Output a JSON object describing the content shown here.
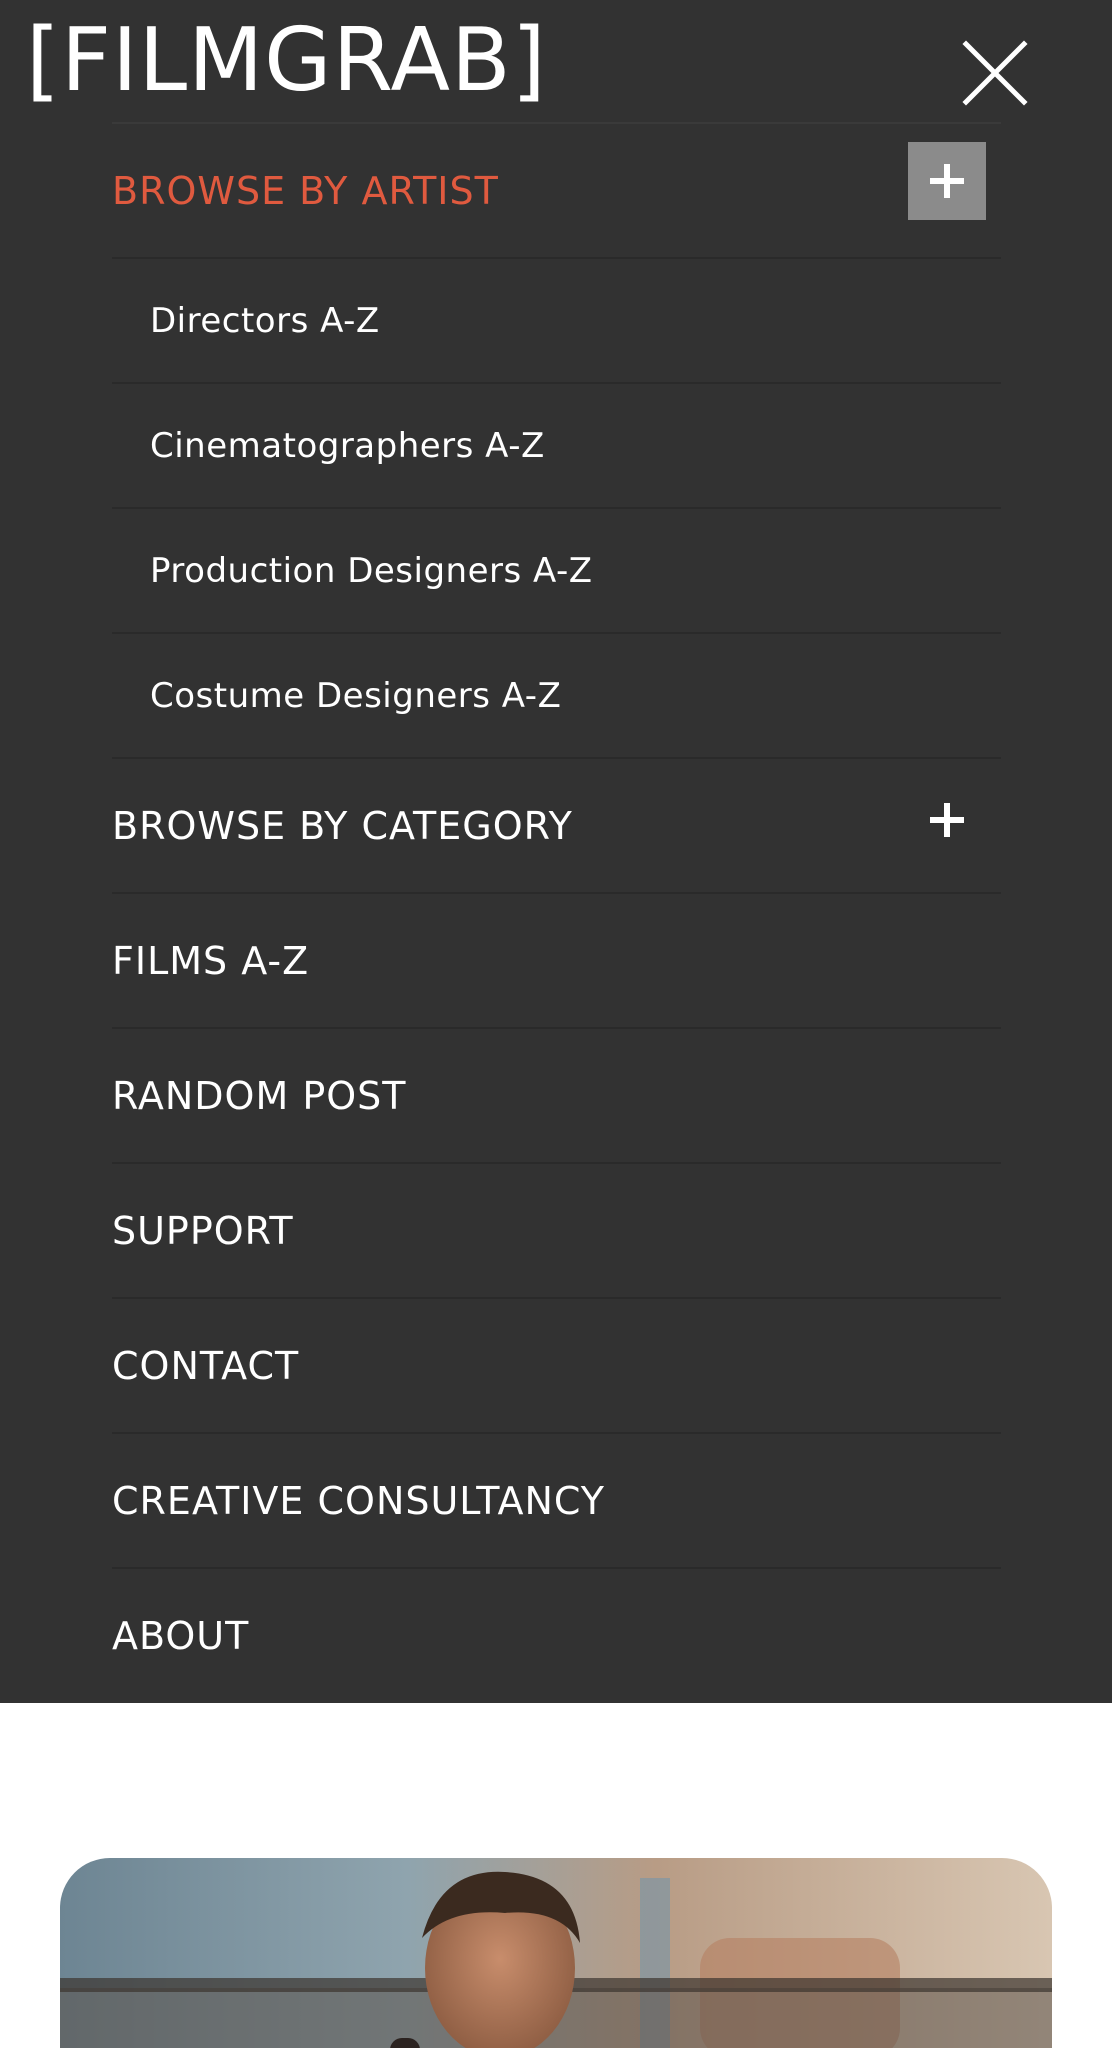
{
  "header": {
    "logo": "[FILMGRAB]",
    "close_icon": "close-icon"
  },
  "colors": {
    "menu_background": "#323232",
    "accent": "#e05a3f",
    "toggle_background": "#8b8b8b",
    "text": "#ffffff",
    "page_background": "#ffffff"
  },
  "menu": {
    "items": [
      {
        "label": "BROWSE BY ARTIST",
        "active": true,
        "expandable": true,
        "icon": "plus-icon",
        "children": [
          {
            "label": "Directors A-Z"
          },
          {
            "label": "Cinematographers A-Z"
          },
          {
            "label": "Production Designers A-Z"
          },
          {
            "label": "Costume Designers A-Z"
          }
        ]
      },
      {
        "label": "BROWSE BY CATEGORY",
        "expandable": true,
        "icon": "plus-icon"
      },
      {
        "label": "FILMS A-Z"
      },
      {
        "label": "RANDOM POST"
      },
      {
        "label": "SUPPORT"
      },
      {
        "label": "CONTACT"
      },
      {
        "label": "CREATIVE CONSULTANCY"
      },
      {
        "label": "ABOUT"
      }
    ]
  },
  "hero": {
    "image": "film-still-photo"
  }
}
